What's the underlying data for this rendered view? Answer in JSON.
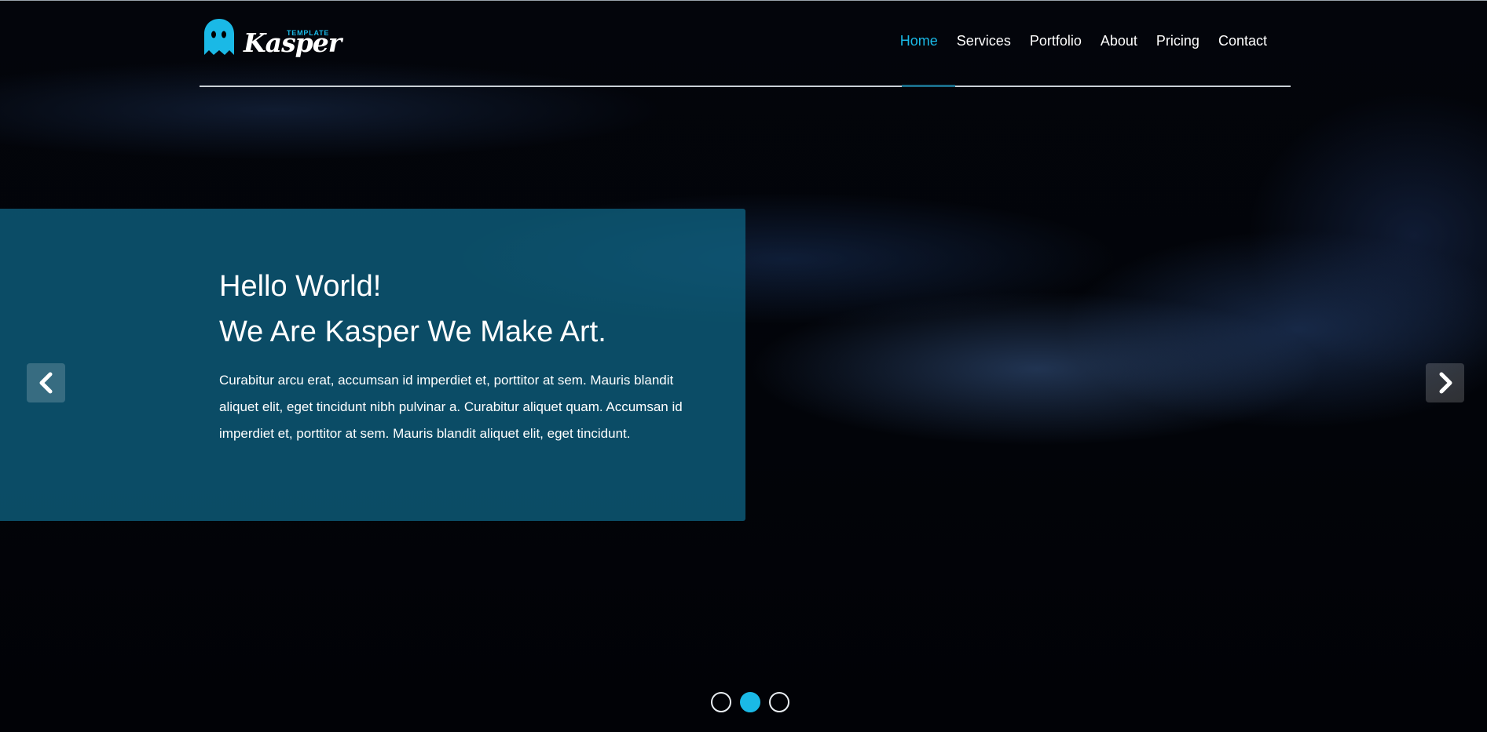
{
  "brand": {
    "name": "Kasper",
    "tagline": "TEMPLATE",
    "accent": "#1ab9e6",
    "logo_icon": "ghost-icon"
  },
  "nav": {
    "items": [
      {
        "label": "Home",
        "active": true
      },
      {
        "label": "Services",
        "active": false
      },
      {
        "label": "Portfolio",
        "active": false
      },
      {
        "label": "About",
        "active": false
      },
      {
        "label": "Pricing",
        "active": false
      },
      {
        "label": "Contact",
        "active": false
      }
    ]
  },
  "slider": {
    "title_line1": "Hello World!",
    "title_line2": "We Are Kasper We Make Art.",
    "text": "Curabitur arcu erat, accumsan id imperdiet et, porttitor at sem. Mauris blandit aliquet elit, eget tincidunt nibh pulvinar a. Curabitur aliquet quam. Accumsan id imperdiet et, porttitor at sem. Mauris blandit aliquet elit, eget tincidunt.",
    "prev_icon": "chevron-left-icon",
    "next_icon": "chevron-right-icon",
    "indicators": 3,
    "active_indicator": 2
  },
  "colors": {
    "background": "#020307",
    "slide_box": "#0e6280",
    "accent": "#1ab9e6"
  }
}
